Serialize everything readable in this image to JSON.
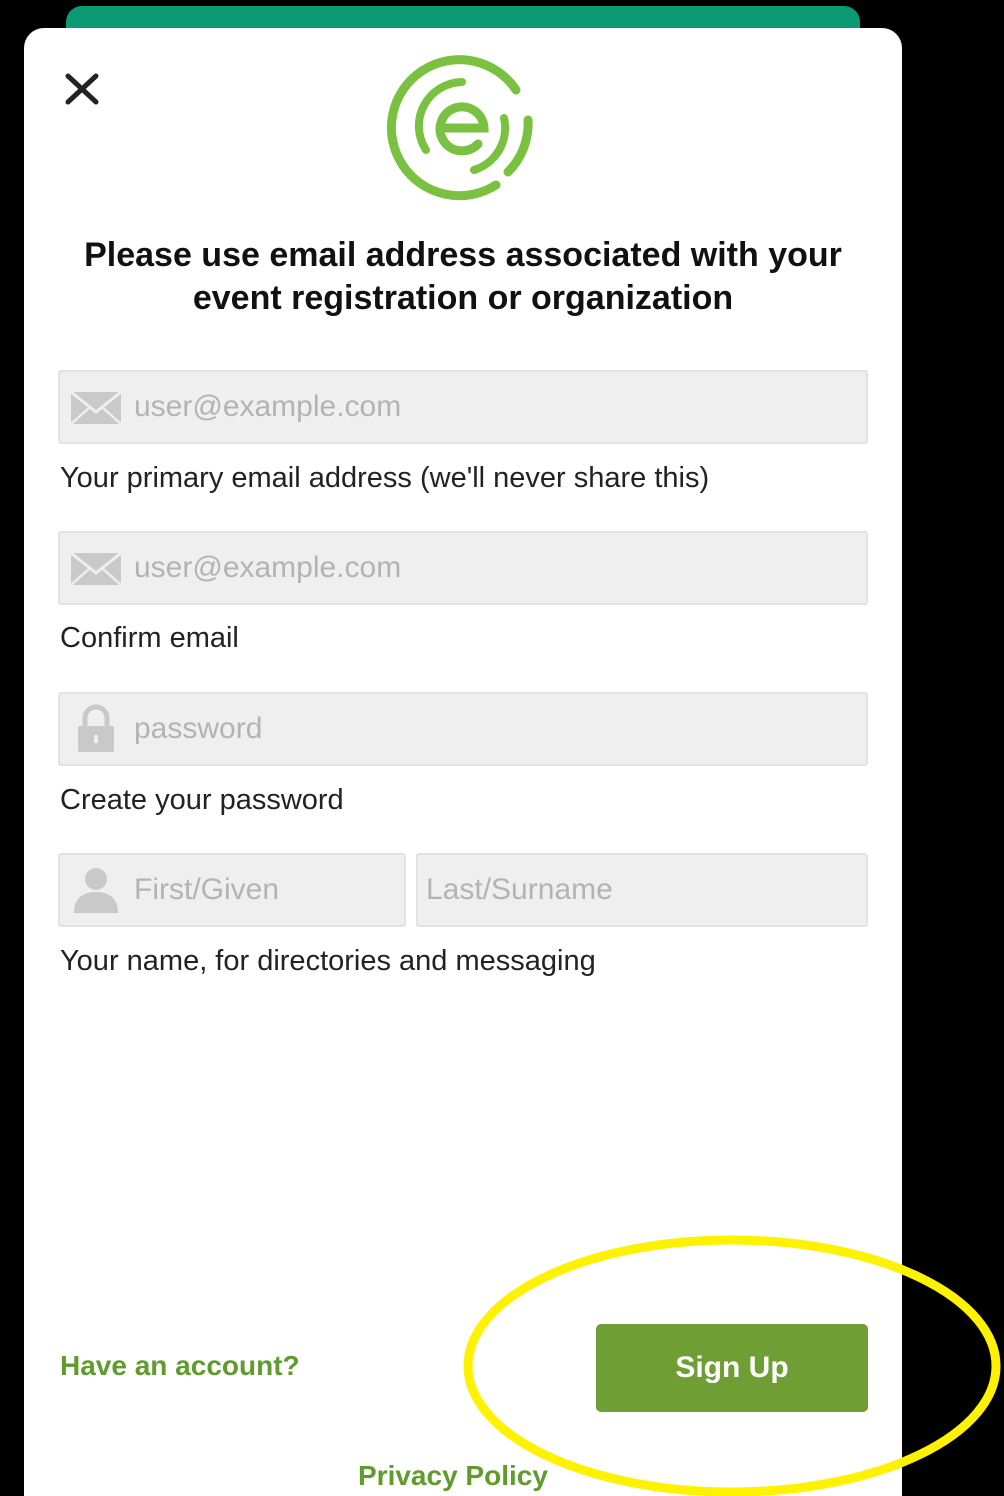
{
  "colors": {
    "brand_green": "#6e9e34",
    "logo_green": "#7ac142",
    "header_teal": "#0c9a74",
    "annotation_yellow": "#fff200"
  },
  "modal": {
    "close_icon": "close-icon",
    "logo_icon": "e-logo-icon",
    "heading": "Please use email address associated with your event registration or organization"
  },
  "form": {
    "email": {
      "icon": "envelope-icon",
      "placeholder": "user@example.com",
      "value": "",
      "helper": "Your primary email address (we'll never share this)"
    },
    "confirm_email": {
      "icon": "envelope-icon",
      "placeholder": "user@example.com",
      "value": "",
      "helper": "Confirm email"
    },
    "password": {
      "icon": "lock-icon",
      "placeholder": "password",
      "value": "",
      "helper": "Create your password"
    },
    "name": {
      "icon": "person-icon",
      "first_placeholder": "First/Given",
      "last_placeholder": "Last/Surname",
      "helper": "Your name, for directories and messaging"
    }
  },
  "footer": {
    "have_account_link": "Have an account?",
    "signup_button": "Sign Up",
    "privacy_link": "Privacy Policy"
  }
}
